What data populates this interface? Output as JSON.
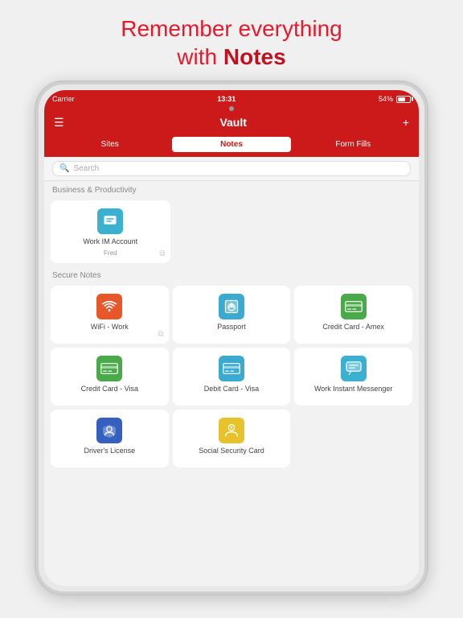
{
  "headline": {
    "line1": "Remember everything",
    "line2": "with ",
    "line2_bold": "Notes"
  },
  "status_bar": {
    "carrier": "Carrier",
    "time": "13:31",
    "battery": "54%"
  },
  "nav": {
    "title": "Vault",
    "menu_icon": "☰",
    "add_icon": "+"
  },
  "tabs": [
    {
      "label": "Sites",
      "active": false
    },
    {
      "label": "Notes",
      "active": true
    },
    {
      "label": "Form Fills",
      "active": false
    }
  ],
  "search": {
    "placeholder": "Search"
  },
  "sections": [
    {
      "title": "Business & Productivity",
      "items": [
        {
          "label": "Work IM Account",
          "sublabel": "Fred",
          "icon_type": "im",
          "copy": true
        }
      ]
    },
    {
      "title": "Secure Notes",
      "items": [
        {
          "label": "WiFi - Work",
          "sublabel": "",
          "icon_type": "wifi",
          "copy": true
        },
        {
          "label": "Passport",
          "sublabel": "",
          "icon_type": "passport",
          "copy": false
        },
        {
          "label": "Credit Card - Amex",
          "sublabel": "",
          "icon_type": "credit-amex",
          "copy": false
        },
        {
          "label": "Credit Card - Visa",
          "sublabel": "",
          "icon_type": "credit-visa",
          "copy": false
        },
        {
          "label": "Debit Card - Visa",
          "sublabel": "",
          "icon_type": "debit",
          "copy": false
        },
        {
          "label": "Work Instant Messenger",
          "sublabel": "",
          "icon_type": "im2",
          "copy": false
        },
        {
          "label": "Driver's License",
          "sublabel": "",
          "icon_type": "driver",
          "copy": false
        },
        {
          "label": "Social Security Card",
          "sublabel": "",
          "icon_type": "ssn",
          "copy": false
        }
      ]
    }
  ]
}
